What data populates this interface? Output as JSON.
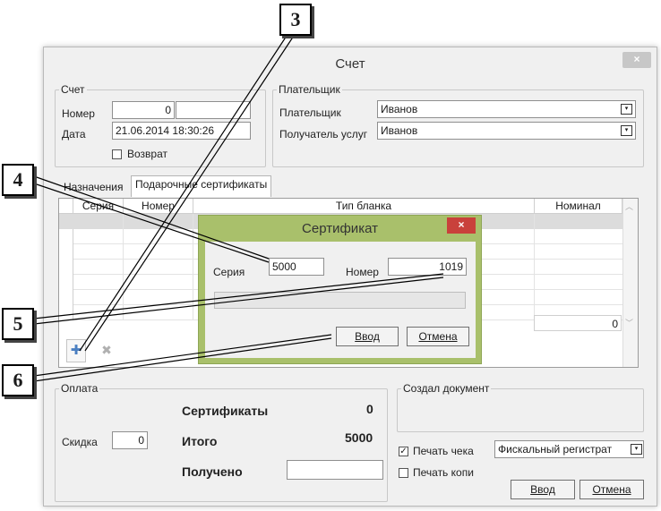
{
  "window": {
    "title": "Счет",
    "close": "×"
  },
  "invoice_group": {
    "legend": "Счет",
    "number_label": "Номер",
    "number_value": "0",
    "date_label": "Дата",
    "date_value": "21.06.2014 18:30:26",
    "return_label": "Возврат"
  },
  "payer_group": {
    "legend": "Плательщик",
    "payer_label": "Плательщик",
    "payer_value": "Иванов",
    "recipient_label": "Получатель услуг",
    "recipient_value": "Иванов"
  },
  "tabs": [
    {
      "label": "Назначения"
    },
    {
      "label": "Подарочные сертификаты"
    }
  ],
  "grid": {
    "columns": [
      "Серия",
      "Номер",
      "Тип бланка",
      "Номинал"
    ],
    "total": "0"
  },
  "certificate_dialog": {
    "title": "Сертификат",
    "close": "×",
    "series_label": "Серия",
    "series_value": "5000",
    "number_label": "Номер",
    "number_value": "1019",
    "ok_label": "Ввод",
    "cancel_label": "Отмена"
  },
  "payment": {
    "legend": "Оплата",
    "certificates_label": "Сертификаты",
    "certificates_value": "0",
    "discount_label": "Скидка",
    "discount_value": "0",
    "total_label": "Итого",
    "total_value": "5000",
    "received_label": "Получено",
    "received_value": ""
  },
  "created_by": {
    "legend": "Создал документ"
  },
  "print": {
    "receipt_label": "Печать чека",
    "receipt_checked": true,
    "copy_label": "Печать копи",
    "device_value": "Фискальный регистрат"
  },
  "footer": {
    "ok_label": "Ввод",
    "cancel_label": "Отмена"
  },
  "callouts": [
    "3",
    "4",
    "5",
    "6"
  ]
}
